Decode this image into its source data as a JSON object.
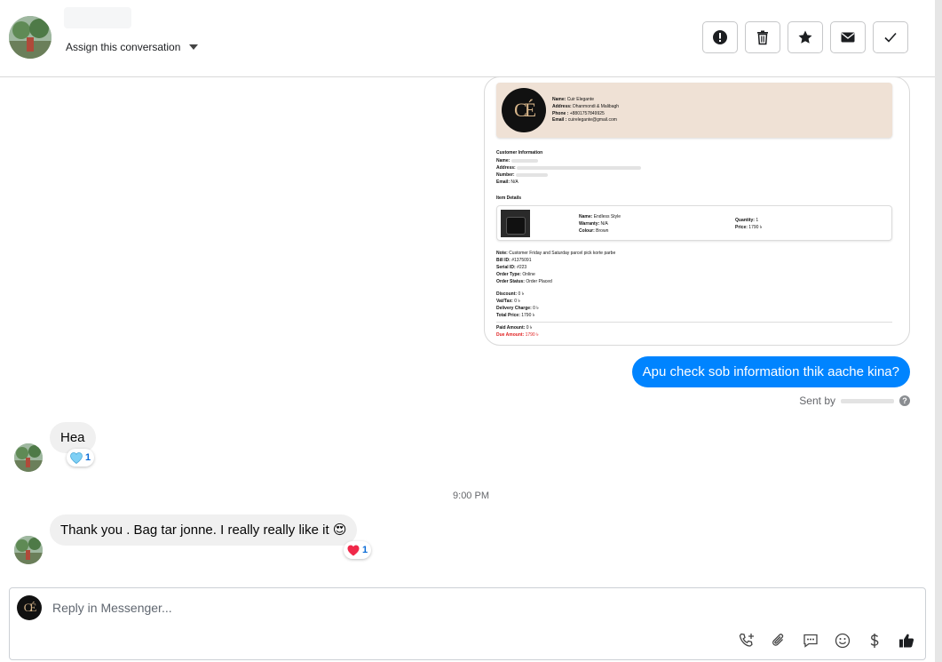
{
  "header": {
    "assign_label": "Assign this conversation"
  },
  "invoice": {
    "logo_text": "CÉ",
    "shop": {
      "name_label": "Name:",
      "name": "Cuir Elegante",
      "address_label": "Address:",
      "address": "Dhanmondi & Malibagh",
      "phone_label": "Phone :",
      "phone": "+8801757849925",
      "email_label": "Email :",
      "email": "cuirelegante@gmail.com"
    },
    "customer_section": "Customer Information",
    "customer": {
      "name_label": "Name:",
      "address_label": "Address:",
      "number_label": "Number:",
      "email_label": "Email:",
      "email": "N/A"
    },
    "item_section": "Item Details",
    "item": {
      "name_label": "Name:",
      "name": "Endless Style",
      "warranty_label": "Warranty:",
      "warranty": "N/A",
      "colour_label": "Colour:",
      "colour": "Brown",
      "quantity_label": "Quantity:",
      "quantity": "1",
      "price_label": "Price:",
      "price": "1790 ৳"
    },
    "note_label": "Note:",
    "note": "Customer Friday and Saturday parcel pick korte parbe",
    "bill_label": "Bill ID:",
    "bill": "#1375091",
    "serial_label": "Serial ID:",
    "serial": "#223",
    "order_type_label": "Order Type:",
    "order_type": "Online",
    "order_status_label": "Order Status:",
    "order_status": "Order Placed",
    "discount_label": "Discount:",
    "discount": "0 ৳",
    "vat_label": "Vat/Tax:",
    "vat": "0 ৳",
    "delivery_label": "Delivery Charge:",
    "delivery": "0 ৳",
    "total_label": "Total Price:",
    "total": "1790 ৳",
    "paid_label": "Paid Amount:",
    "paid": "0 ৳",
    "due_label": "Due Amount:",
    "due": "1790 ৳"
  },
  "messages": {
    "outgoing_text": "Apu check sob information thik aache kina?",
    "sent_by_label": "Sent by",
    "hea_text": "Hea",
    "hea_reaction_count": "1",
    "timestamp": "9:00 PM",
    "thanks_text": "Thank you . Bag tar jonne. I really really like it",
    "thanks_emoji": "😍",
    "thanks_reaction_count": "1"
  },
  "composer": {
    "avatar_text": "CÉ",
    "placeholder": "Reply in Messenger..."
  },
  "colors": {
    "accent": "#0084ff",
    "due_red": "#e02020",
    "invoice_header": "#efe1d5"
  }
}
